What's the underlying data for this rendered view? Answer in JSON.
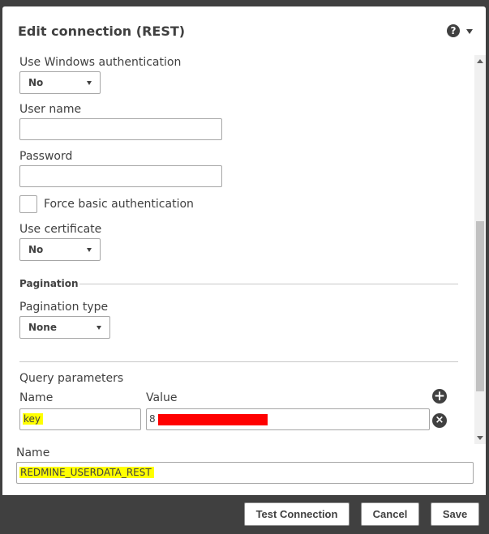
{
  "dialog": {
    "title": "Edit connection (REST)",
    "help_icon": "help-icon",
    "help_symbol": "?"
  },
  "form": {
    "windows_auth": {
      "label": "Use Windows authentication",
      "value": "No"
    },
    "user_name": {
      "label": "User name",
      "value": ""
    },
    "password": {
      "label": "Password",
      "value": ""
    },
    "force_basic_auth": {
      "label": "Force basic authentication",
      "checked": false
    },
    "use_certificate": {
      "label": "Use certificate",
      "value": "No"
    },
    "pagination": {
      "section_title": "Pagination",
      "type_label": "Pagination type",
      "type_value": "None"
    },
    "query_parameters": {
      "section_title": "Query parameters",
      "name_header": "Name",
      "value_header": "Value",
      "rows": [
        {
          "name": "key",
          "value": "8"
        }
      ],
      "add_icon": "plus-circle-icon",
      "remove_icon": "x-circle-icon"
    }
  },
  "connection_name": {
    "label": "Name",
    "value": "REDMINE_USERDATA_REST"
  },
  "buttons": {
    "test_connection": "Test Connection",
    "cancel": "Cancel",
    "save": "Save"
  },
  "colors": {
    "dark_bg": "#404040",
    "highlight": "#ffff00",
    "redaction": "#ff0000"
  }
}
